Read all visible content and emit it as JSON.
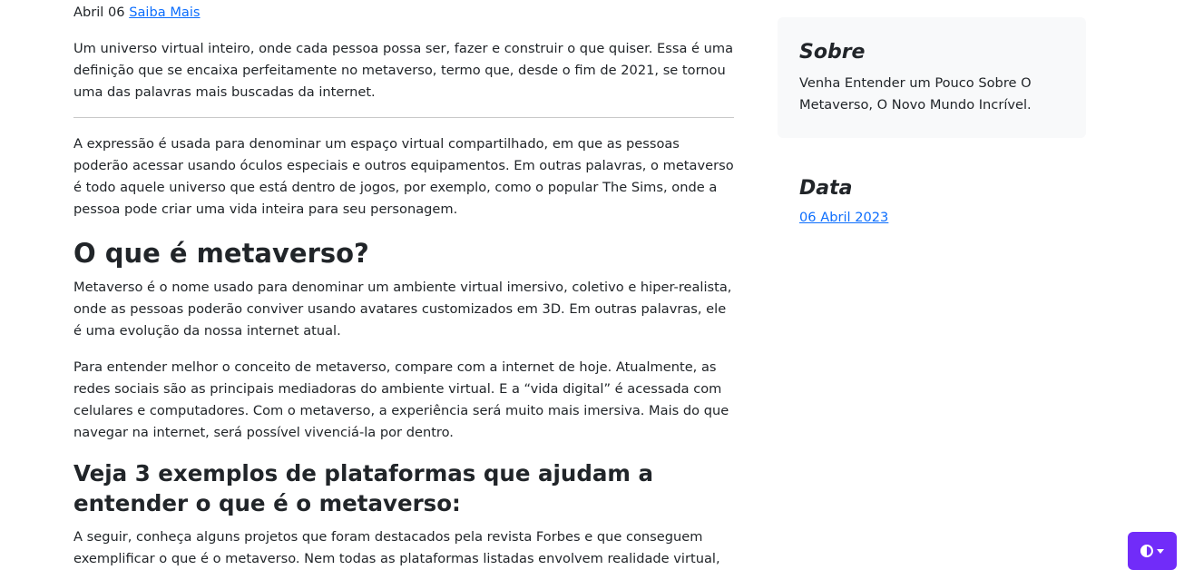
{
  "post": {
    "date_text": "Abril 06",
    "read_more_link": "Saiba Mais",
    "intro": "Um universo virtual inteiro, onde cada pessoa possa ser, fazer e construir o que quiser. Essa é uma definição que se encaixa perfeitamente no metaverso, termo que, desde o fim de 2021, se tornou uma das palavras mais buscadas da internet.",
    "paragraph_2": "A expressão é usada para denominar um espaço virtual compartilhado, em que as pessoas poderão acessar usando óculos especiais e outros equipamentos. Em outras palavras, o metaverso é todo aquele universo que está dentro de jogos, por exemplo, como o popular The Sims, onde a pessoa pode criar uma vida inteira para seu personagem.",
    "heading_1": "O que é metaverso?",
    "paragraph_3": "Metaverso é o nome usado para denominar um ambiente virtual imersivo, coletivo e hiper-realista, onde as pessoas poderão conviver usando avatares customizados em 3D. Em outras palavras, ele é uma evolução da nossa internet atual.",
    "paragraph_4": "Para entender melhor o conceito de metaverso, compare com a internet de hoje. Atualmente, as redes sociais são as principais mediadoras do ambiente virtual. E a “vida digital” é acessada com celulares e computadores. Com o metaverso, a experiência será muito mais imersiva. Mais do que navegar na internet, será possível vivenciá-la por dentro.",
    "heading_2": "Veja 3 exemplos de plataformas que ajudam a entender o que é o metaverso:",
    "paragraph_5": "A seguir, conheça alguns projetos que foram destacados pela revista Forbes e que conseguem exemplificar o que é o metaverso. Nem todas as plataformas listadas envolvem realidade virtual,"
  },
  "sidebar": {
    "about_title": "Sobre",
    "about_text": "Venha Entender um Pouco Sobre O Metaverso, O Novo Mundo Incrível.",
    "date_title": "Data",
    "date_link": "06 Abril 2023"
  },
  "theme_toggle": {
    "icon": "contrast-icon",
    "color": "#712cf9"
  },
  "colors": {
    "link": "#0d6efd",
    "text": "#212529",
    "sidebar_bg": "#f8f9fa"
  }
}
